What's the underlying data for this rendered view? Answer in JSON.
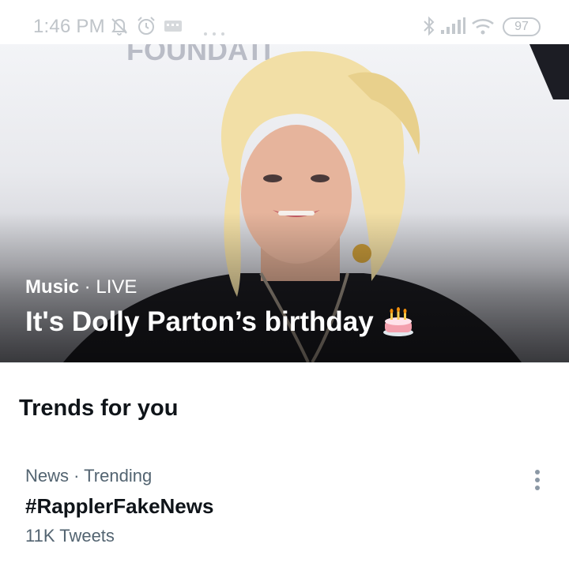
{
  "status_bar": {
    "time": "1:46 PM",
    "battery": "97",
    "icons": [
      "bell-off-icon",
      "alarm-icon",
      "message-icon",
      "more-dots-icon",
      "bluetooth-icon",
      "signal-icon",
      "wifi-icon",
      "battery-icon"
    ]
  },
  "hero": {
    "category": "Music",
    "separator": " · ",
    "status": "LIVE",
    "title": "It's Dolly Parton’s birthday",
    "emoji_icon": "birthday-cake-icon",
    "background_text": "FOUNDATI"
  },
  "trends": {
    "title": "Trends for you",
    "items": [
      {
        "category": "News",
        "separator": " · ",
        "status": "Trending",
        "name": "#RapplerFakeNews",
        "count": "11K Tweets",
        "menu_icon": "more-vertical-icon"
      }
    ]
  },
  "colors": {
    "text_primary": "#0f1419",
    "text_secondary": "#536471",
    "status_gray": "#bfc4c9"
  }
}
